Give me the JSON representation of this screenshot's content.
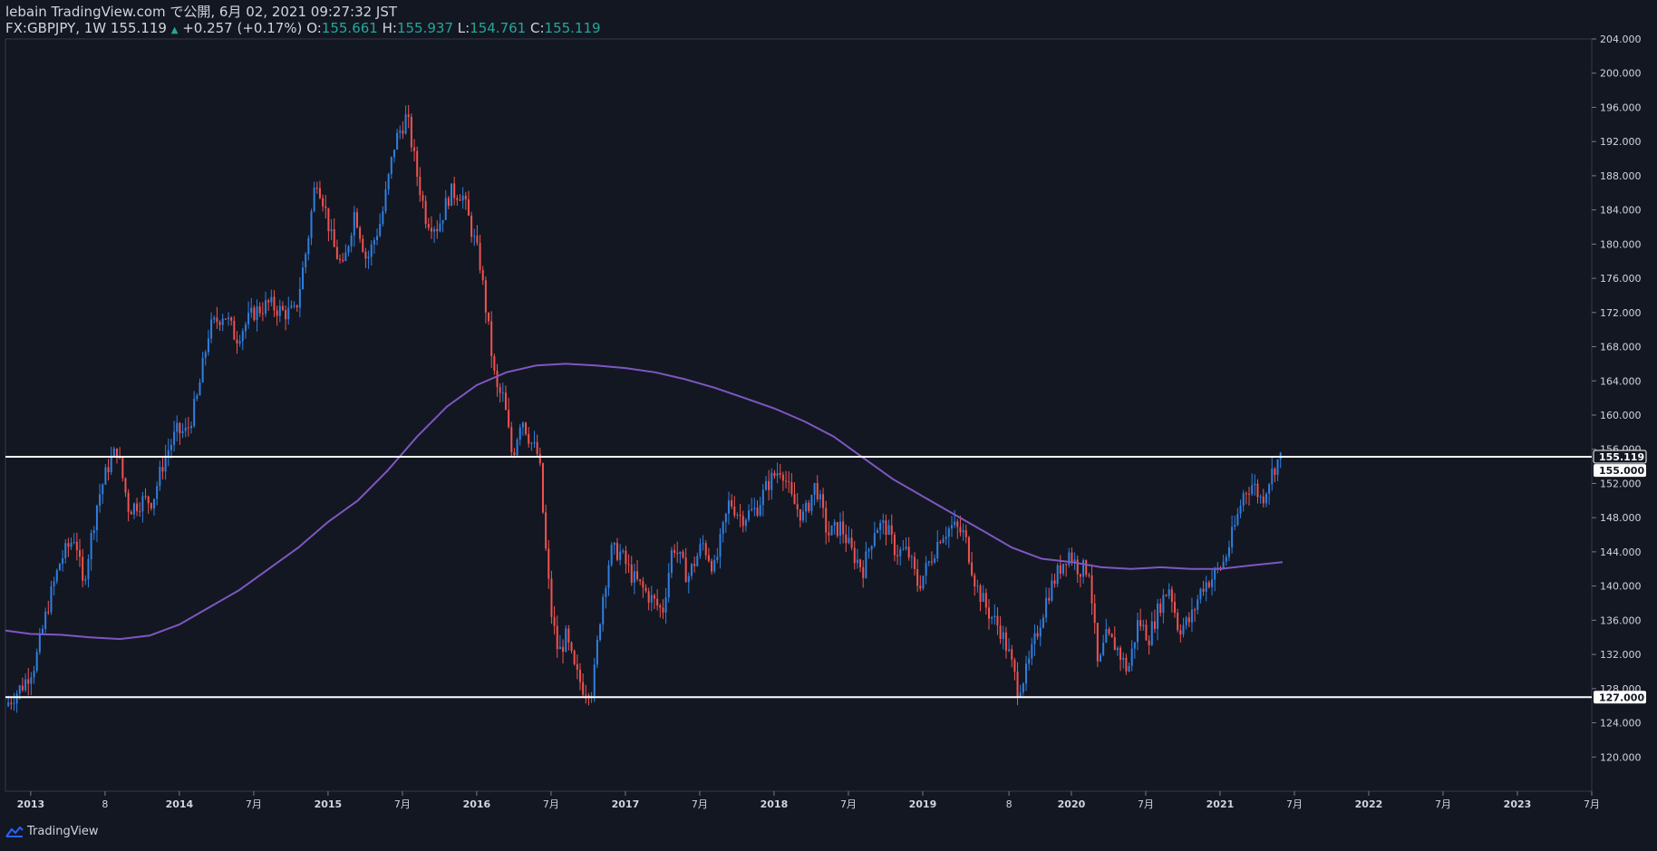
{
  "header": {
    "published": "lebain TradingView.com で公開, 6月 02, 2021 09:27:32 JST",
    "symbol": "FX:GBPJPY, 1W 155.119",
    "change_arrow": "▲",
    "change": "+0.257 (+0.17%)",
    "o_label": " O:",
    "o_value": "155.661",
    "h_label": " H:",
    "h_value": "155.937",
    "l_label": " L:",
    "l_value": "154.761",
    "c_label": " C:",
    "c_value": "155.119"
  },
  "footer": {
    "brand": "TradingView"
  },
  "colors": {
    "up": "#2962ff",
    "up_light": "#2f7fe0",
    "down": "#ef5350",
    "ma": "#7e57c2",
    "hline": "#ffffff",
    "grid_text": "#d1d4dc",
    "background": "#131722"
  },
  "chart_data": {
    "type": "candlestick",
    "symbol": "GBPJPY",
    "interval": "1W",
    "ylim": [
      116.0,
      204.0
    ],
    "y_ticks": [
      "120.000",
      "124.000",
      "128.000",
      "132.000",
      "136.000",
      "140.000",
      "144.000",
      "148.000",
      "152.000",
      "156.000",
      "160.000",
      "164.000",
      "168.000",
      "172.000",
      "176.000",
      "180.000",
      "184.000",
      "188.000",
      "192.000",
      "196.000",
      "200.000",
      "204.000"
    ],
    "x_tick_labels": [
      "2013",
      "8",
      "2014",
      "7月",
      "2015",
      "7月",
      "2016",
      "7月",
      "2017",
      "7月",
      "2018",
      "7月",
      "2019",
      "8",
      "2020",
      "7月",
      "2021",
      "7月",
      "2022",
      "7月",
      "2023",
      "7月"
    ],
    "x_tick_times": [
      2013.0,
      2013.5,
      2014.0,
      2014.5,
      2015.0,
      2015.5,
      2016.0,
      2016.5,
      2017.0,
      2017.5,
      2018.0,
      2018.5,
      2019.0,
      2019.58,
      2020.0,
      2020.5,
      2021.0,
      2021.5,
      2022.0,
      2022.5,
      2023.0,
      2023.5
    ],
    "x_range": [
      2012.83,
      2023.5
    ],
    "price_path": [
      [
        2012.83,
        126.0
      ],
      [
        2012.95,
        128.5
      ],
      [
        2013.03,
        131.0
      ],
      [
        2013.12,
        138.0
      ],
      [
        2013.2,
        143.0
      ],
      [
        2013.3,
        146.0
      ],
      [
        2013.35,
        140.0
      ],
      [
        2013.45,
        150.0
      ],
      [
        2013.52,
        154.0
      ],
      [
        2013.58,
        156.0
      ],
      [
        2013.66,
        149.0
      ],
      [
        2013.75,
        150.0
      ],
      [
        2013.82,
        150.0
      ],
      [
        2013.9,
        155.0
      ],
      [
        2013.98,
        158.0
      ],
      [
        2014.05,
        158.0
      ],
      [
        2014.12,
        162.0
      ],
      [
        2014.2,
        170.0
      ],
      [
        2014.3,
        172.0
      ],
      [
        2014.38,
        169.0
      ],
      [
        2014.5,
        172.0
      ],
      [
        2014.6,
        173.0
      ],
      [
        2014.7,
        172.0
      ],
      [
        2014.78,
        172.0
      ],
      [
        2014.86,
        180.0
      ],
      [
        2014.92,
        188.0
      ],
      [
        2014.97,
        185.0
      ],
      [
        2015.03,
        180.0
      ],
      [
        2015.1,
        177.0
      ],
      [
        2015.18,
        184.0
      ],
      [
        2015.26,
        178.0
      ],
      [
        2015.36,
        183.0
      ],
      [
        2015.45,
        192.0
      ],
      [
        2015.53,
        195.0
      ],
      [
        2015.6,
        188.0
      ],
      [
        2015.66,
        183.0
      ],
      [
        2015.74,
        182.0
      ],
      [
        2015.82,
        186.0
      ],
      [
        2015.9,
        186.0
      ],
      [
        2015.96,
        182.0
      ],
      [
        2016.02,
        178.0
      ],
      [
        2016.08,
        170.0
      ],
      [
        2016.13,
        163.0
      ],
      [
        2016.18,
        162.0
      ],
      [
        2016.24,
        155.0
      ],
      [
        2016.3,
        160.0
      ],
      [
        2016.36,
        157.0
      ],
      [
        2016.42,
        155.0
      ],
      [
        2016.46,
        145.0
      ],
      [
        2016.5,
        137.0
      ],
      [
        2016.55,
        132.0
      ],
      [
        2016.6,
        134.0
      ],
      [
        2016.66,
        130.0
      ],
      [
        2016.72,
        128.0
      ],
      [
        2016.78,
        128.0
      ],
      [
        2016.84,
        138.0
      ],
      [
        2016.9,
        144.0
      ],
      [
        2016.96,
        144.0
      ],
      [
        2017.05,
        141.0
      ],
      [
        2017.15,
        139.0
      ],
      [
        2017.25,
        137.0
      ],
      [
        2017.32,
        145.0
      ],
      [
        2017.42,
        141.0
      ],
      [
        2017.52,
        145.0
      ],
      [
        2017.6,
        142.0
      ],
      [
        2017.7,
        150.0
      ],
      [
        2017.78,
        148.0
      ],
      [
        2017.88,
        149.0
      ],
      [
        2017.96,
        152.0
      ],
      [
        2018.05,
        154.0
      ],
      [
        2018.12,
        150.0
      ],
      [
        2018.2,
        148.0
      ],
      [
        2018.28,
        152.0
      ],
      [
        2018.36,
        146.0
      ],
      [
        2018.45,
        147.0
      ],
      [
        2018.52,
        144.0
      ],
      [
        2018.6,
        142.0
      ],
      [
        2018.68,
        147.0
      ],
      [
        2018.75,
        147.0
      ],
      [
        2018.82,
        144.0
      ],
      [
        2018.9,
        144.0
      ],
      [
        2018.97,
        140.0
      ],
      [
        2019.05,
        143.0
      ],
      [
        2019.12,
        146.0
      ],
      [
        2019.2,
        147.0
      ],
      [
        2019.28,
        146.0
      ],
      [
        2019.36,
        140.0
      ],
      [
        2019.44,
        137.0
      ],
      [
        2019.52,
        135.0
      ],
      [
        2019.58,
        132.0
      ],
      [
        2019.64,
        128.0
      ],
      [
        2019.7,
        130.0
      ],
      [
        2019.76,
        134.0
      ],
      [
        2019.84,
        139.0
      ],
      [
        2019.92,
        142.0
      ],
      [
        2019.98,
        144.0
      ],
      [
        2020.05,
        142.0
      ],
      [
        2020.12,
        142.0
      ],
      [
        2020.18,
        130.0
      ],
      [
        2020.23,
        134.0
      ],
      [
        2020.3,
        133.0
      ],
      [
        2020.38,
        130.0
      ],
      [
        2020.45,
        136.0
      ],
      [
        2020.52,
        134.0
      ],
      [
        2020.6,
        138.0
      ],
      [
        2020.66,
        140.0
      ],
      [
        2020.72,
        135.0
      ],
      [
        2020.8,
        136.0
      ],
      [
        2020.88,
        140.0
      ],
      [
        2020.95,
        141.0
      ],
      [
        2021.03,
        143.0
      ],
      [
        2021.1,
        147.0
      ],
      [
        2021.16,
        151.0
      ],
      [
        2021.22,
        152.0
      ],
      [
        2021.28,
        150.0
      ],
      [
        2021.33,
        152.5
      ],
      [
        2021.38,
        154.5
      ],
      [
        2021.42,
        155.119
      ]
    ],
    "moving_average": [
      [
        2012.83,
        134.8
      ],
      [
        2013.0,
        134.4
      ],
      [
        2013.2,
        134.3
      ],
      [
        2013.4,
        134.0
      ],
      [
        2013.6,
        133.8
      ],
      [
        2013.8,
        134.2
      ],
      [
        2014.0,
        135.5
      ],
      [
        2014.2,
        137.5
      ],
      [
        2014.4,
        139.5
      ],
      [
        2014.6,
        142.0
      ],
      [
        2014.8,
        144.5
      ],
      [
        2015.0,
        147.5
      ],
      [
        2015.2,
        150.0
      ],
      [
        2015.4,
        153.5
      ],
      [
        2015.6,
        157.5
      ],
      [
        2015.8,
        161.0
      ],
      [
        2016.0,
        163.5
      ],
      [
        2016.2,
        165.0
      ],
      [
        2016.4,
        165.8
      ],
      [
        2016.6,
        166.0
      ],
      [
        2016.8,
        165.8
      ],
      [
        2017.0,
        165.5
      ],
      [
        2017.2,
        165.0
      ],
      [
        2017.4,
        164.2
      ],
      [
        2017.6,
        163.2
      ],
      [
        2017.8,
        162.0
      ],
      [
        2018.0,
        160.8
      ],
      [
        2018.2,
        159.3
      ],
      [
        2018.4,
        157.5
      ],
      [
        2018.6,
        155.0
      ],
      [
        2018.8,
        152.5
      ],
      [
        2019.0,
        150.5
      ],
      [
        2019.2,
        148.5
      ],
      [
        2019.4,
        146.5
      ],
      [
        2019.6,
        144.5
      ],
      [
        2019.8,
        143.2
      ],
      [
        2020.0,
        142.8
      ],
      [
        2020.2,
        142.2
      ],
      [
        2020.4,
        142.0
      ],
      [
        2020.6,
        142.2
      ],
      [
        2020.8,
        142.0
      ],
      [
        2021.0,
        142.0
      ],
      [
        2021.2,
        142.4
      ],
      [
        2021.42,
        142.8
      ]
    ],
    "horizontal_lines": [
      {
        "value": 155.119,
        "label": "155.119",
        "style": "current"
      },
      {
        "value": 155.0,
        "label": "155.000",
        "style": "level"
      },
      {
        "value": 127.0,
        "label": "127.000",
        "style": "level"
      }
    ]
  }
}
